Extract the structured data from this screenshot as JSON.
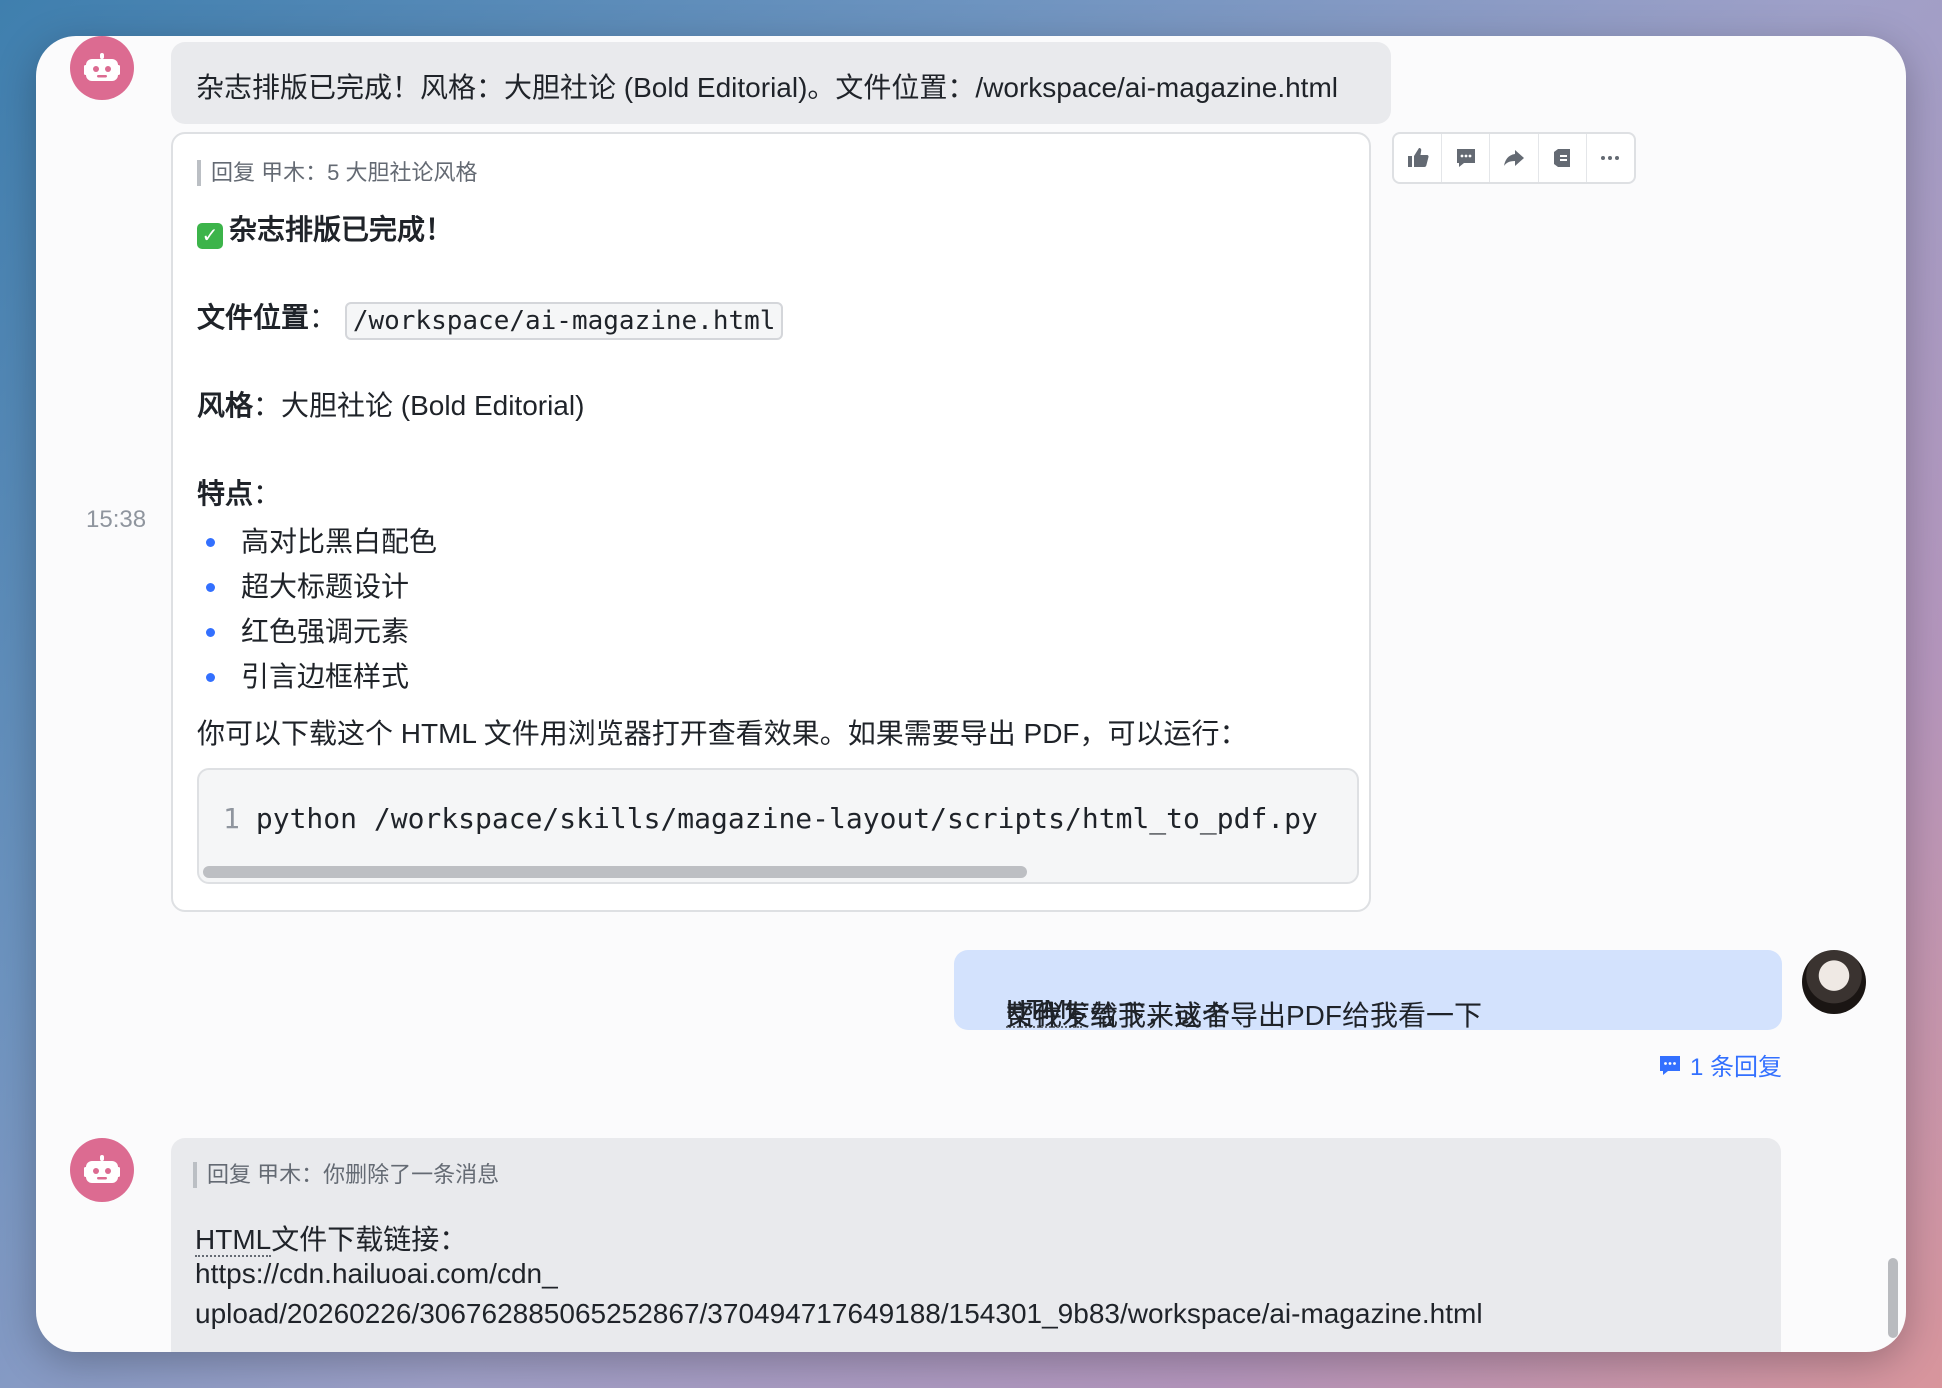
{
  "colors": {
    "accent": "#3370ff",
    "bot_avatar": "#dc6b91",
    "user_bubble": "#d3e2fd",
    "bot_bubble": "#e9eaed",
    "success": "#3cb44a"
  },
  "messages": {
    "timestamp": "15:38",
    "bot_title": "杂志排版已完成！风格：大胆社论 (Bold Editorial)。文件位置：/workspace/ai-magazine.html",
    "card": {
      "reply_ref": "回复 甲木：5 大胆社论风格",
      "heading": "杂志排版已完成！",
      "file_label": "文件位置",
      "file_colon": "：",
      "file_path": "/workspace/ai-magazine.html",
      "style_label": "风格",
      "style_value": "：大胆社论 (Bold Editorial)",
      "features_label": "特点",
      "features_colon": "：",
      "features": [
        "高对比黑白配色",
        "超大标题设计",
        "红色强调元素",
        "引言边框样式"
      ],
      "hint": "你可以下载这个 HTML 文件用浏览器打开查看效果。如果需要导出 PDF，可以运行：",
      "code_line_no": "1",
      "code": "python /workspace/skills/magazine-layout/scripts/html_to_pdf.py"
    },
    "toolbar": [
      "thumbs-up-icon",
      "comment-icon",
      "forward-icon",
      "pin-icon",
      "more-icon"
    ],
    "user_msg": {
      "before": "帮我下载下来这个",
      "underlined": "HTML",
      "after": "文件发给我，或者导出PDF给我看一下"
    },
    "reply_count": "1 条回复",
    "bot_reply": {
      "reply_ref": "回复 甲木：你删除了一条消息",
      "line1_underlined": "HTML",
      "line1_rest": "文件下载链接：",
      "link": "https://cdn.hailuoai.com/cdn_",
      "path": "upload/20260226/306762885065252867/370494717649188/154301_9b83/workspace/ai-magazine.html"
    }
  }
}
